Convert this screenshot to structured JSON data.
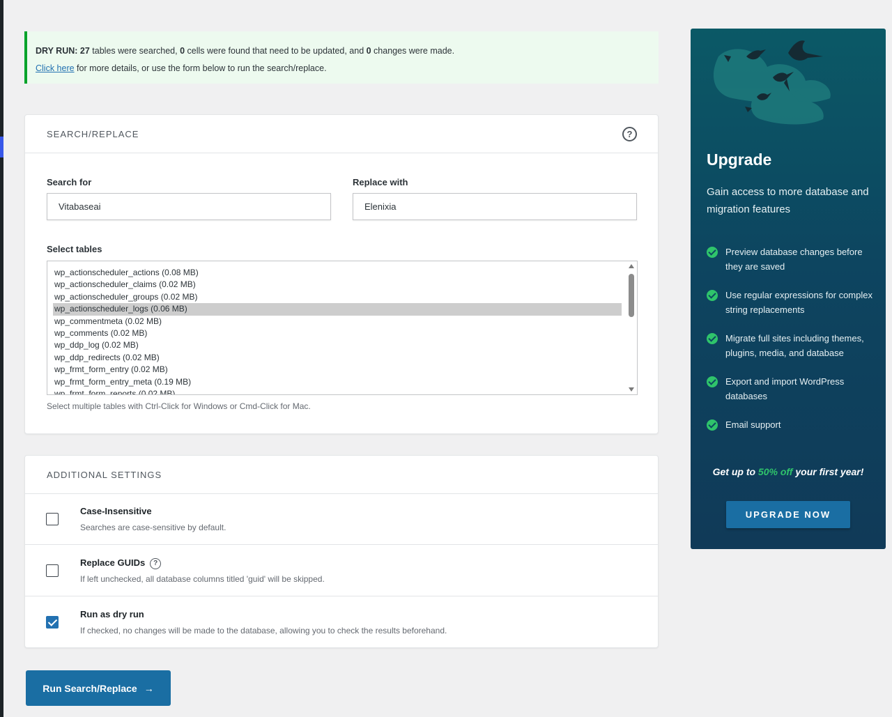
{
  "notice": {
    "prefix": "DRY RUN:",
    "tables_count": "27",
    "part1": " tables were searched, ",
    "cells_count": "0",
    "part2": " cells were found that need to be updated, and ",
    "changes_count": "0",
    "part3": " changes were made.",
    "link_text": "Click here",
    "line2_rest": " for more details, or use the form below to run the search/replace."
  },
  "search_replace": {
    "title": "SEARCH/REPLACE",
    "help_glyph": "?",
    "search_label": "Search for",
    "search_value": "Vitabaseai",
    "replace_label": "Replace with",
    "replace_value": "Elenixia",
    "tables_label": "Select tables",
    "tables": [
      "wp_actionscheduler_actions (0.08 MB)",
      "wp_actionscheduler_claims (0.02 MB)",
      "wp_actionscheduler_groups (0.02 MB)",
      "wp_actionscheduler_logs (0.06 MB)",
      "wp_commentmeta (0.02 MB)",
      "wp_comments (0.02 MB)",
      "wp_ddp_log (0.02 MB)",
      "wp_ddp_redirects (0.02 MB)",
      "wp_frmt_form_entry (0.02 MB)",
      "wp_frmt_form_entry_meta (0.19 MB)",
      "wp_frmt_form_reports (0.02 MB)"
    ],
    "selected_table": "wp_actionscheduler_logs (0.06 MB)",
    "hint": "Select multiple tables with Ctrl-Click for Windows or Cmd-Click for Mac."
  },
  "additional_settings": {
    "title": "ADDITIONAL SETTINGS",
    "help_glyph": "?",
    "options": [
      {
        "title": "Case-Insensitive",
        "desc": "Searches are case-sensitive by default.",
        "checked": false
      },
      {
        "title": "Replace GUIDs",
        "desc": "If left unchecked, all database columns titled 'guid' will be skipped.",
        "checked": false
      },
      {
        "title": "Run as dry run",
        "desc": "If checked, no changes will be made to the database, allowing you to check the results beforehand.",
        "checked": true
      }
    ]
  },
  "run_button": {
    "label": "Run Search/Replace",
    "arrow": "→"
  },
  "upgrade": {
    "title": "Upgrade",
    "subtitle": "Gain access to more database and migration features",
    "features": [
      "Preview database changes before they are saved",
      "Use regular expressions for complex string replacements",
      "Migrate full sites including themes, plugins, media, and database",
      "Export and import WordPress databases",
      "Email support"
    ],
    "promo_pre": "Get up to ",
    "promo_accent": "50% off",
    "promo_post": " your first year!",
    "button_label": "UPGRADE NOW"
  },
  "colors": {
    "accent_blue": "#1a6ea3",
    "success_green": "#00a32a",
    "check_green": "#2fc46b",
    "panel_teal": "#0d4560"
  }
}
